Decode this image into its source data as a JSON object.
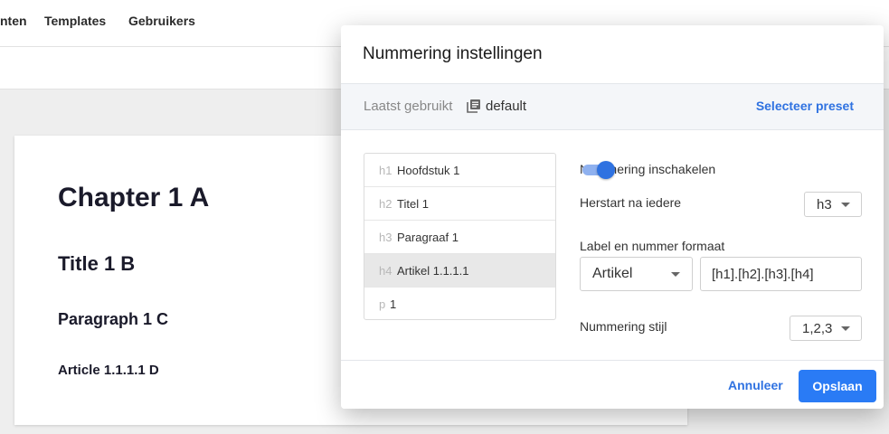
{
  "nav": {
    "items": [
      "nten",
      "Templates",
      "Gebruikers"
    ]
  },
  "document": {
    "h1": "Chapter 1 A",
    "h2": "Title 1 B",
    "h3": "Paragraph 1 C",
    "h4": "Article 1.1.1.1 D"
  },
  "dialog": {
    "title": "Nummering instellingen",
    "preset": {
      "label": "Laatst gebruikt",
      "icon": "library-icon",
      "name": "default",
      "select_label": "Selecteer preset"
    },
    "levels": [
      {
        "tag": "h1",
        "text": "Hoofdstuk 1"
      },
      {
        "tag": "h2",
        "text": "Titel 1"
      },
      {
        "tag": "h3",
        "text": "Paragraaf 1"
      },
      {
        "tag": "h4",
        "text": "Artikel 1.1.1.1",
        "selected": true
      },
      {
        "tag": "p",
        "text": "1"
      }
    ],
    "settings": {
      "enable_label": "Nummering inschakelen",
      "enabled": true,
      "restart_label": "Herstart na iedere",
      "restart_value": "h3",
      "format_label": "Label en nummer formaat",
      "label_value": "Artikel",
      "format_value": "[h1].[h2].[h3].[h4]",
      "style_label": "Nummering stijl",
      "style_value": "1,2,3"
    },
    "footer": {
      "cancel_label": "Annuleer",
      "save_label": "Opslaan"
    }
  },
  "colors": {
    "accent": "#2f72e1",
    "primary_button": "#2a7bf5",
    "toggle_track": "#8fb1ef"
  }
}
